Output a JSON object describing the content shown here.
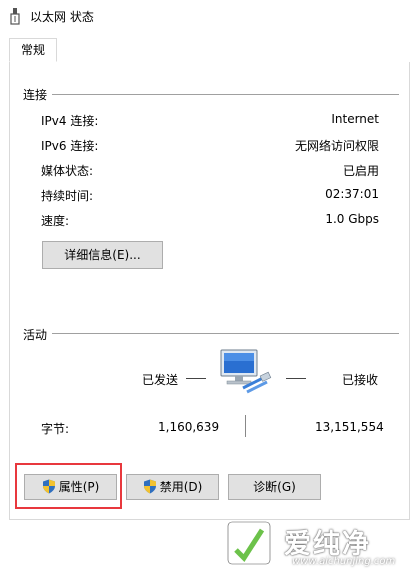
{
  "window": {
    "title": "以太网 状态"
  },
  "tabs": [
    {
      "label": "常规"
    }
  ],
  "connection": {
    "section_title": "连接",
    "rows": [
      {
        "label": "IPv4 连接:",
        "value": "Internet"
      },
      {
        "label": "IPv6 连接:",
        "value": "无网络访问权限"
      },
      {
        "label": "媒体状态:",
        "value": "已启用"
      },
      {
        "label": "持续时间:",
        "value": "02:37:01"
      },
      {
        "label": "速度:",
        "value": "1.0 Gbps"
      }
    ],
    "details_button": "详细信息(E)..."
  },
  "activity": {
    "section_title": "活动",
    "sent_label": "已发送",
    "received_label": "已接收",
    "bytes_label": "字节:",
    "bytes_sent": "1,160,639",
    "bytes_received": "13,151,554"
  },
  "buttons": {
    "properties": "属性(P)",
    "disable": "禁用(D)",
    "diagnose": "诊断(G)"
  },
  "watermark": {
    "name": "爱纯净",
    "url": "www.aichunjing.com"
  },
  "colors": {
    "highlight_box": "#e8383d",
    "button_bg": "#e1e1e1"
  }
}
